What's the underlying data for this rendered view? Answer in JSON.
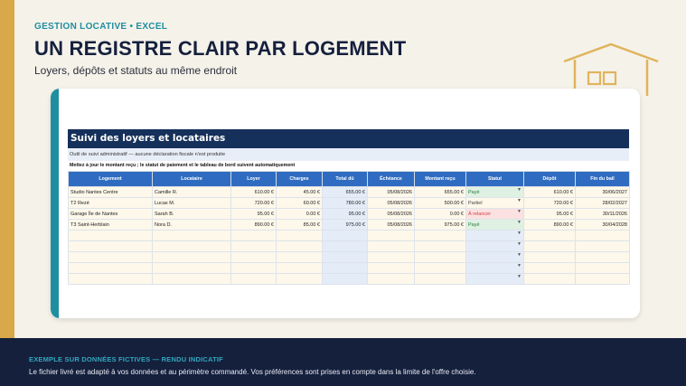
{
  "header": {
    "kicker": "GESTION LOCATIVE • EXCEL",
    "title": "UN REGISTRE CLAIR PAR LOGEMENT",
    "subtitle": "Loyers, dépôts et statuts au même endroit"
  },
  "sheet": {
    "title": "Suivi des loyers et locataires",
    "note1": "Outil de suivi administratif — aucune déclaration fiscale n'est produite",
    "note2": "Mettez à jour le montant reçu ; le statut de paiement et le tableau de bord suivent automatiquement",
    "columns": [
      "Logement",
      "Locataire",
      "Loyer",
      "Charges",
      "Total dû",
      "Échéance",
      "Montant reçu",
      "Statut",
      "Dépôt",
      "Fin du bail"
    ],
    "rows": [
      [
        "Studio Nantes Centre",
        "Camille R.",
        "610.00 €",
        "45.00 €",
        "655.00 €",
        "05/08/2026",
        "655.00 €",
        "Payé",
        "610.00 €",
        "30/06/2027"
      ],
      [
        "T2 Rezé",
        "Lucas M.",
        "720.00 €",
        "60.00 €",
        "780.00 €",
        "05/08/2026",
        "500.00 €",
        "Partiel",
        "720.00 €",
        "28/02/2027"
      ],
      [
        "Garage Île de Nantes",
        "Sarah B.",
        "95.00 €",
        "0.00 €",
        "95.00 €",
        "05/08/2026",
        "0.00 €",
        "À relancer",
        "95.00 €",
        "30/11/2026"
      ],
      [
        "T3 Saint-Herblain",
        "Nora D.",
        "890.00 €",
        "85.00 €",
        "975.00 €",
        "05/08/2026",
        "975.00 €",
        "Payé",
        "890.00 €",
        "30/04/2028"
      ]
    ],
    "statuses": [
      "paye",
      "partiel",
      "relancer",
      "paye"
    ],
    "empty_rows": 5
  },
  "footer": {
    "kicker": "EXEMPLE SUR DONNÉES FICTIVES — RENDU INDICATIF",
    "text": "Le fichier livré est adapté à vos données et au périmètre commandé. Vos préférences sont prises en compte dans la limite de l'offre choisie."
  },
  "colors": {
    "accent_gold": "#d9a84a",
    "accent_teal": "#1f8ea0",
    "navy": "#15203d",
    "header_blue": "#2f6cc1"
  },
  "icons": [
    "house-icon"
  ]
}
